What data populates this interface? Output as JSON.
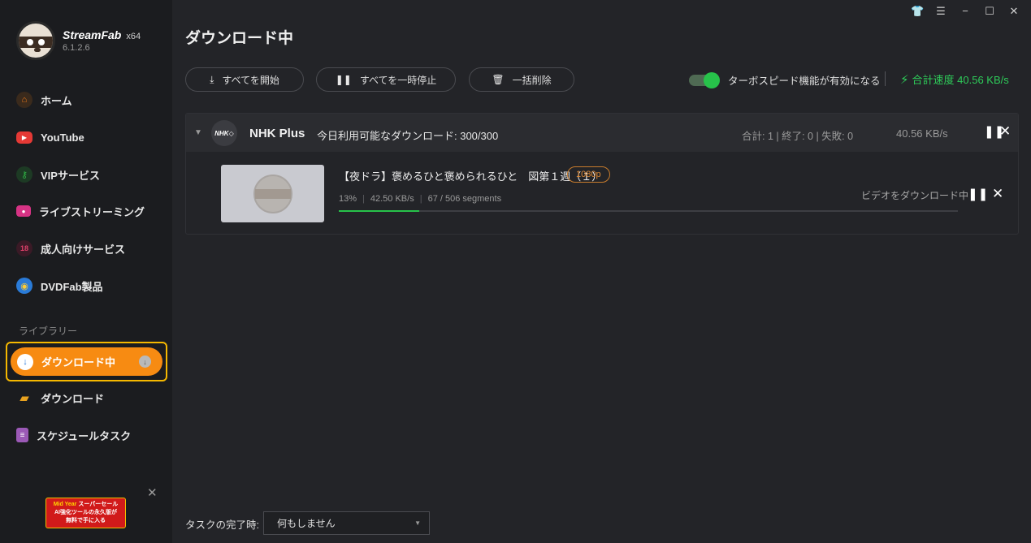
{
  "app": {
    "name": "StreamFab",
    "arch": "x64",
    "version": "6.1.2.6"
  },
  "window_controls": [
    "shirt-icon",
    "menu-icon",
    "minimize-icon",
    "maximize-icon",
    "close-icon"
  ],
  "sidebar": {
    "items": [
      {
        "label": "ホーム",
        "icon": "home-icon",
        "color": "#f07a1a"
      },
      {
        "label": "YouTube",
        "icon": "youtube-icon",
        "color": "#e53935"
      },
      {
        "label": "VIPサービス",
        "icon": "key-icon",
        "color": "#2fb344"
      },
      {
        "label": "ライブストリーミング",
        "icon": "camera-icon",
        "color": "#d63384"
      },
      {
        "label": "成人向けサービス",
        "icon": "adult-icon",
        "color": "#c2185b"
      },
      {
        "label": "DVDFab製品",
        "icon": "dvdfab-icon",
        "color": "#2a7bd8"
      }
    ],
    "library_label": "ライブラリー",
    "library": [
      {
        "label": "ダウンロード中",
        "icon": "download-icon",
        "active": true
      },
      {
        "label": "ダウンロード",
        "icon": "folder-icon",
        "color": "#e9a21f"
      },
      {
        "label": "スケジュールタスク",
        "icon": "schedule-icon",
        "color": "#9b59b6"
      }
    ],
    "promo": {
      "line1_a": "Mid Year",
      "line1_b": "スーパーセール",
      "line2": "AI強化ツールの永久版が",
      "line3": "無料で手に入る"
    }
  },
  "page_title": "ダウンロード中",
  "toolbar": {
    "start_all": "すべてを開始",
    "pause_all": "すべてを一時停止",
    "delete_all": "一括削除",
    "turbo_label": "ターボスピード機能が有効になる",
    "turbo_on": true,
    "total_speed": "合計速度 40.56 KB/s"
  },
  "group": {
    "site_logo_text": "NHK",
    "site_name": "NHK Plus",
    "quota": "今日利用可能なダウンロード: 300/300",
    "stats": "合計: 1 | 終了: 0 | 失敗: 0",
    "speed": "40.56 KB/s",
    "items": [
      {
        "title": "【夜ドラ】褒めるひと褒められるひと　図第１週（１）",
        "resolution": "1080p",
        "percent": "13%",
        "speed": "42.50 KB/s",
        "segments": "67 / 506 segments",
        "status": "ビデオをダウンロード中",
        "progress": 0.13
      }
    ]
  },
  "footer": {
    "on_complete_label": "タスクの完了時:",
    "on_complete_value": "何もしません"
  }
}
